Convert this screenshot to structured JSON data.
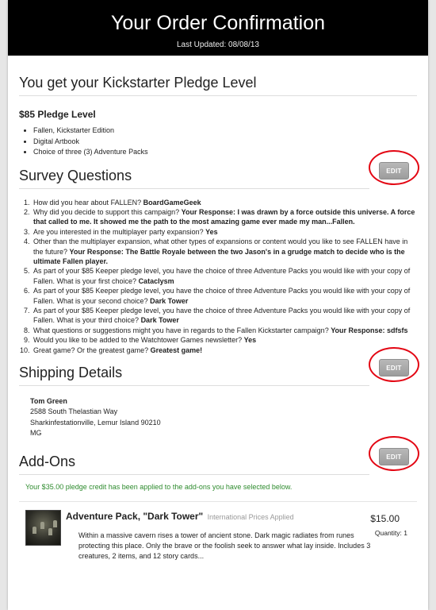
{
  "header": {
    "title": "Your Order Confirmation",
    "updated": "Last Updated: 08/08/13"
  },
  "pledge": {
    "title": "You get your Kickstarter Pledge Level",
    "level": "$85 Pledge Level",
    "items": [
      "Fallen, Kickstarter Edition",
      "Digital Artbook",
      "Choice of three (3) Adventure Packs"
    ]
  },
  "survey": {
    "title": "Survey Questions",
    "edit_label": "EDIT",
    "questions": [
      {
        "q": "How did you hear about FALLEN? ",
        "a": "BoardGameGeek"
      },
      {
        "q": "Why did you decide to support this campaign? ",
        "a": "Your Response: I was drawn by a force outside this universe. A force that called to me. It showed me the path to the most amazing game ever made my man...Fallen."
      },
      {
        "q": "Are you interested in the multiplayer party expansion? ",
        "a": "Yes"
      },
      {
        "q": "Other than the multiplayer expansion, what other types of expansions or content would you like to see FALLEN have in the future? ",
        "a": "Your Response: The Battle Royale between the two Jason's in a grudge match to decide who is the ultimate Fallen player."
      },
      {
        "q": "As part of your $85 Keeper pledge level, you have the choice of three Adventure Packs you would like with your copy of Fallen. What is your first choice? ",
        "a": "Cataclysm"
      },
      {
        "q": "As part of your $85 Keeper pledge level, you have the choice of three Adventure Packs you would like with your copy of Fallen. What is your second choice? ",
        "a": "Dark Tower"
      },
      {
        "q": "As part of your $85 Keeper pledge level, you have the choice of three Adventure Packs you would like with your copy of Fallen. What is your third choice? ",
        "a": "Dark Tower"
      },
      {
        "q": "What questions or suggestions might you have in regards to the Fallen Kickstarter campaign? ",
        "a": "Your Response: sdfsfs"
      },
      {
        "q": "Would you like to be added to the Watchtower Games newsletter? ",
        "a": "Yes"
      },
      {
        "q": "Great game? Or the greatest game? ",
        "a": "Greatest game!"
      }
    ]
  },
  "shipping": {
    "title": "Shipping Details",
    "edit_label": "EDIT",
    "name": "Tom Green",
    "street": "2588 South Thelastian Way",
    "city": "Sharkinfestationville, Lemur Island 90210",
    "country": "MG"
  },
  "addons": {
    "title": "Add-Ons",
    "edit_label": "EDIT",
    "credit": "Your $35.00 pledge credit has been applied to the add-ons you have selected below.",
    "item": {
      "title": "Adventure Pack, \"Dark Tower\"",
      "note": "International Prices Applied",
      "price": "$15.00",
      "quantity": "Quantity: 1",
      "description": "Within a massive cavern rises a tower of ancient stone. Dark magic radiates from runes protecting this place. Only the brave or the foolish seek to answer what lay inside. Includes 3 creatures, 2 items, and 12 story cards..."
    }
  },
  "colors": {
    "accent_ring": "#e30613",
    "credit_text": "#2e8b2e",
    "header_bg": "#000000"
  }
}
